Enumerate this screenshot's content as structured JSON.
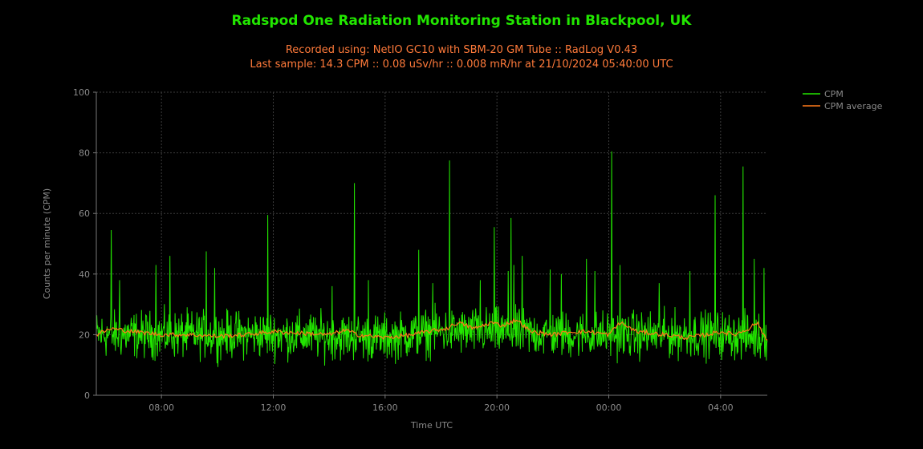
{
  "header": {
    "title": "Radspod One Radiation Monitoring Station in Blackpool, UK",
    "subtitle_line1": "Recorded using: NetIO GC10 with SBM-20 GM Tube :: RadLog V0.43",
    "subtitle_line2": "Last sample: 14.3 CPM :: 0.08 uSv/hr :: 0.008 mR/hr at 21/10/2024 05:40:00 UTC"
  },
  "colors": {
    "cpm": "#22e600",
    "average": "#ff7a1a",
    "title": "#22e600",
    "subtitle": "#ff7a3a",
    "grid": "#3c3c3c",
    "background": "#000000"
  },
  "chart_data": {
    "type": "line",
    "title": "Radspod One Radiation Monitoring Station in Blackpool, UK",
    "xlabel": "Time UTC",
    "ylabel": "Counts per minute (CPM)",
    "x_range_hours": [
      "2024-10-20 05:40",
      "2024-10-21 05:40"
    ],
    "xticks": [
      "08:00",
      "12:00",
      "16:00",
      "20:00",
      "00:00",
      "04:00"
    ],
    "xtick_hours": [
      8,
      12,
      16,
      20,
      24,
      28
    ],
    "ylim": [
      0,
      100
    ],
    "yticks": [
      0,
      20,
      40,
      60,
      80,
      100
    ],
    "grid": true,
    "legend_position": "top-right",
    "series": [
      {
        "name": "CPM",
        "baseline_hours": [
          5.67,
          8,
          12,
          16,
          18,
          20,
          22,
          24,
          28,
          29.67
        ],
        "baseline_cpm": [
          20,
          20,
          20,
          19,
          21,
          21,
          20,
          20,
          20,
          19
        ],
        "spikes": [
          {
            "hour": 6.2,
            "cpm": 54.5
          },
          {
            "hour": 6.5,
            "cpm": 38
          },
          {
            "hour": 7.8,
            "cpm": 43
          },
          {
            "hour": 8.3,
            "cpm": 46
          },
          {
            "hour": 9.6,
            "cpm": 47.5
          },
          {
            "hour": 9.9,
            "cpm": 42
          },
          {
            "hour": 11.8,
            "cpm": 59.5
          },
          {
            "hour": 14.1,
            "cpm": 36
          },
          {
            "hour": 14.9,
            "cpm": 70
          },
          {
            "hour": 15.4,
            "cpm": 38
          },
          {
            "hour": 17.2,
            "cpm": 48
          },
          {
            "hour": 17.7,
            "cpm": 37
          },
          {
            "hour": 18.3,
            "cpm": 77.5
          },
          {
            "hour": 19.4,
            "cpm": 38
          },
          {
            "hour": 19.9,
            "cpm": 55.5
          },
          {
            "hour": 20.4,
            "cpm": 41
          },
          {
            "hour": 20.5,
            "cpm": 58.5
          },
          {
            "hour": 20.6,
            "cpm": 43
          },
          {
            "hour": 20.9,
            "cpm": 46
          },
          {
            "hour": 21.9,
            "cpm": 41.5
          },
          {
            "hour": 22.3,
            "cpm": 40
          },
          {
            "hour": 23.2,
            "cpm": 45
          },
          {
            "hour": 23.5,
            "cpm": 41
          },
          {
            "hour": 24.1,
            "cpm": 80.5
          },
          {
            "hour": 24.4,
            "cpm": 43
          },
          {
            "hour": 25.8,
            "cpm": 37
          },
          {
            "hour": 26.9,
            "cpm": 41
          },
          {
            "hour": 27.8,
            "cpm": 66
          },
          {
            "hour": 28.8,
            "cpm": 75.5
          },
          {
            "hour": 29.2,
            "cpm": 45
          },
          {
            "hour": 29.55,
            "cpm": 42
          }
        ]
      },
      {
        "name": "CPM average",
        "x_hours": [
          5.67,
          6.2,
          7.0,
          8.0,
          9.0,
          10.0,
          11.0,
          12.0,
          13.0,
          14.0,
          14.6,
          15.0,
          16.0,
          17.0,
          17.5,
          18.2,
          18.6,
          19.2,
          19.8,
          20.2,
          20.7,
          21.2,
          22.0,
          22.7,
          23.3,
          24.0,
          24.4,
          25.0,
          26.0,
          26.8,
          27.5,
          28.0,
          28.5,
          29.0,
          29.3,
          29.67
        ],
        "y_values": [
          20,
          22,
          21,
          20,
          20,
          19.5,
          20,
          21,
          20.5,
          20,
          21.5,
          20,
          19,
          20,
          21,
          22,
          24,
          22,
          24,
          23,
          25,
          21,
          20,
          21,
          21,
          20,
          24,
          21,
          20,
          19,
          20,
          21,
          20,
          22,
          24,
          18
        ]
      }
    ]
  }
}
